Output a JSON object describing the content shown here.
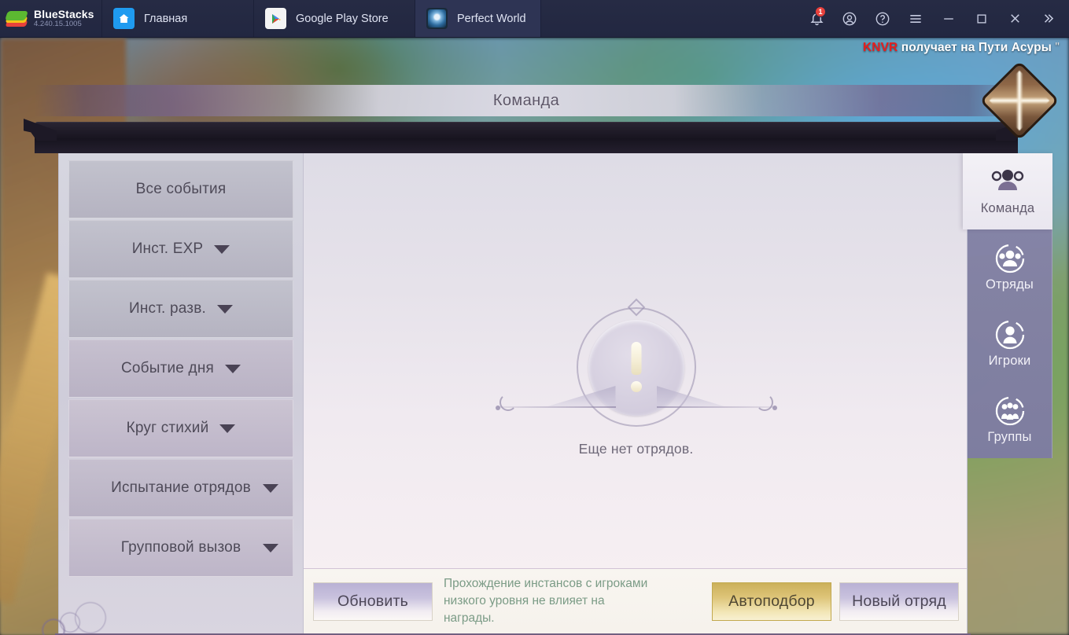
{
  "titlebar": {
    "brand": {
      "name": "BlueStacks",
      "version": "4.240.15.1005",
      "logo_icon": "bluestacks-logo"
    },
    "tabs": [
      {
        "label": "Главная",
        "icon": "home-icon",
        "active": false
      },
      {
        "label": "Google Play Store",
        "icon": "google-play-icon",
        "active": false
      },
      {
        "label": "Perfect World",
        "icon": "perfect-world-icon",
        "active": true
      }
    ],
    "controls": [
      {
        "name": "notifications-icon",
        "badge": "1"
      },
      {
        "name": "account-icon"
      },
      {
        "name": "help-icon"
      },
      {
        "name": "menu-icon"
      },
      {
        "name": "minimize-icon"
      },
      {
        "name": "maximize-icon"
      },
      {
        "name": "close-icon"
      },
      {
        "name": "expand-sidebar-icon"
      }
    ]
  },
  "announcement": {
    "player": "KNVR",
    "text": " получает на Пути Асуры",
    "tail": " \""
  },
  "window": {
    "title": "Команда",
    "close_icon": "diamond-close-icon"
  },
  "left_menu": {
    "items": [
      {
        "label": "Все события",
        "has_caret": false
      },
      {
        "label": "Инст. EXP",
        "has_caret": true
      },
      {
        "label": "Инст. разв.",
        "has_caret": true
      },
      {
        "label": "Событие дня",
        "has_caret": true
      },
      {
        "label": "Круг стихий",
        "has_caret": true
      },
      {
        "label": "Испытание отрядов",
        "has_caret": true
      },
      {
        "label": "Групповой вызов",
        "has_caret": true
      }
    ]
  },
  "content": {
    "empty_state_text": "Еще нет отрядов.",
    "empty_state_icon": "exclamation-emblem-icon"
  },
  "bottom_bar": {
    "refresh_label": "Обновить",
    "hint": "Прохождение инстансов с игроками низкого уровня не влияет на награды.",
    "auto_match_label": "Автоподбор",
    "new_squad_label": "Новый отряд"
  },
  "right_rail": {
    "tabs": [
      {
        "label": "Команда",
        "icon": "team-icon",
        "active": true
      },
      {
        "label": "Отряды",
        "icon": "squads-icon",
        "active": false
      },
      {
        "label": "Игроки",
        "icon": "players-icon",
        "active": false
      },
      {
        "label": "Группы",
        "icon": "groups-icon",
        "active": false
      }
    ]
  },
  "colors": {
    "titlebar_bg": "#262b44",
    "accent_red": "#e8413c",
    "announce_red": "#e51f1f",
    "gold_button": "#ddc478",
    "lilac_button": "#c9c2de",
    "hint_green": "#7b9b86",
    "rail_bg": "#87859f"
  }
}
